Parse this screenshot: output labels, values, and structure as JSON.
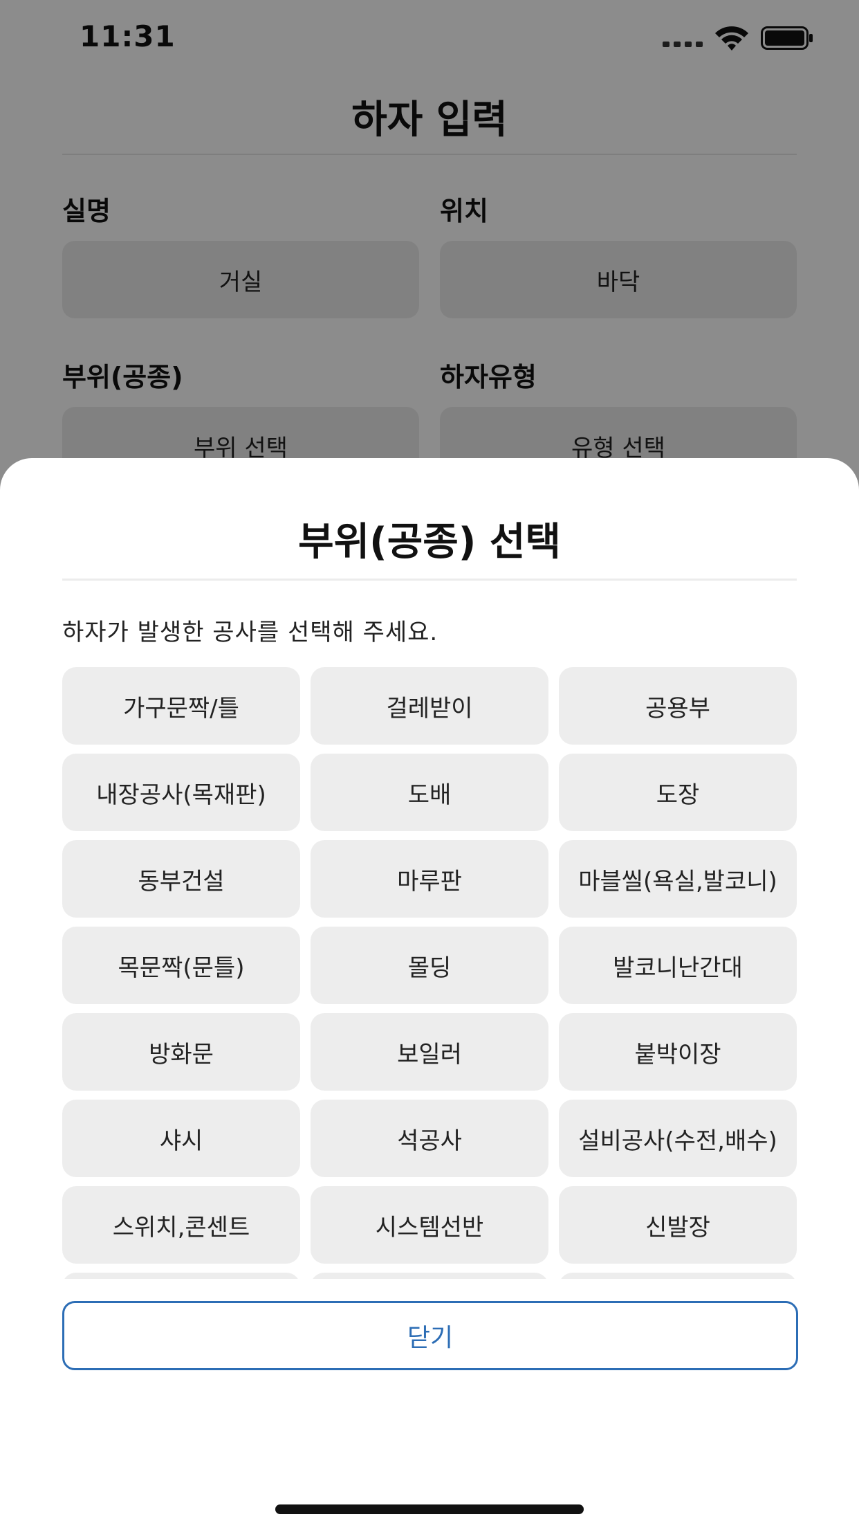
{
  "status_bar": {
    "time": "11:31"
  },
  "page": {
    "title": "하자 입력",
    "fields": [
      {
        "label": "실명",
        "value": "거실"
      },
      {
        "label": "위치",
        "value": "바닥"
      },
      {
        "label": "부위(공종)",
        "value": "부위 선택"
      },
      {
        "label": "하자유형",
        "value": "유형 선택"
      }
    ]
  },
  "sheet": {
    "title": "부위(공종) 선택",
    "description": "하자가 발생한 공사를 선택해 주세요.",
    "options": [
      "가구문짝/틀",
      "걸레받이",
      "공용부",
      "내장공사(목재판)",
      "도배",
      "도장",
      "동부건설",
      "마루판",
      "마블씰(욕실,발코니)",
      "목문짝(문틀)",
      "몰딩",
      "발코니난간대",
      "방화문",
      "보일러",
      "붙박이장",
      "샤시",
      "석공사",
      "설비공사(수전,배수)",
      "스위치,콘센트",
      "시스템선반",
      "신발장",
      "",
      "",
      ""
    ],
    "close_label": "닫기"
  },
  "colors": {
    "accent": "#2c6db5",
    "chip_bg": "#ededed",
    "overlay": "rgba(0,0,0,0.45)"
  }
}
